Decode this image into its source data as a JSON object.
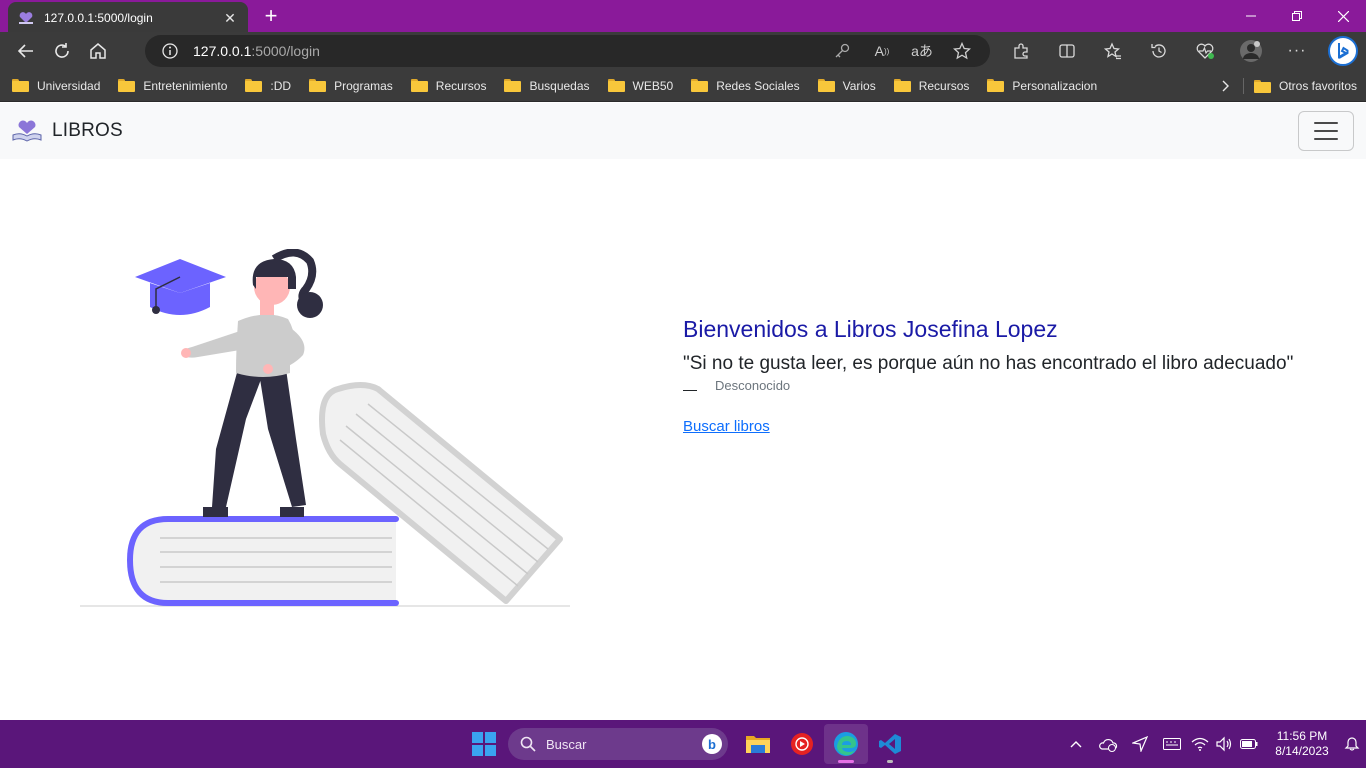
{
  "browser": {
    "tab_title": "127.0.0.1:5000/login",
    "url_host": "127.0.0.1",
    "url_rest": ":5000/login",
    "bookmarks": [
      "Universidad",
      "Entretenimiento",
      ":DD",
      "Programas",
      "Recursos",
      "Busquedas",
      "WEB50",
      "Redes Sociales",
      "Varios",
      "Recursos",
      "Personalizacion"
    ],
    "other_favorites": "Otros favoritos"
  },
  "site": {
    "brand": "LIBROS",
    "hero_title": "Bienvenidos a Libros Josefina Lopez",
    "quote": "\"Si no te gusta leer, es porque aún no has encontrado el libro adecuado\"",
    "author": "Desconocido",
    "search_link": "Buscar libros"
  },
  "taskbar": {
    "search_placeholder": "Buscar",
    "time": "11:56 PM",
    "date": "8/14/2023"
  },
  "colors": {
    "titlebar": "#8a1a9a",
    "taskbar": "#5a167a",
    "accent_purple": "#6c63ff",
    "hero_title": "#1a1aa6",
    "link": "#0d6efd"
  }
}
